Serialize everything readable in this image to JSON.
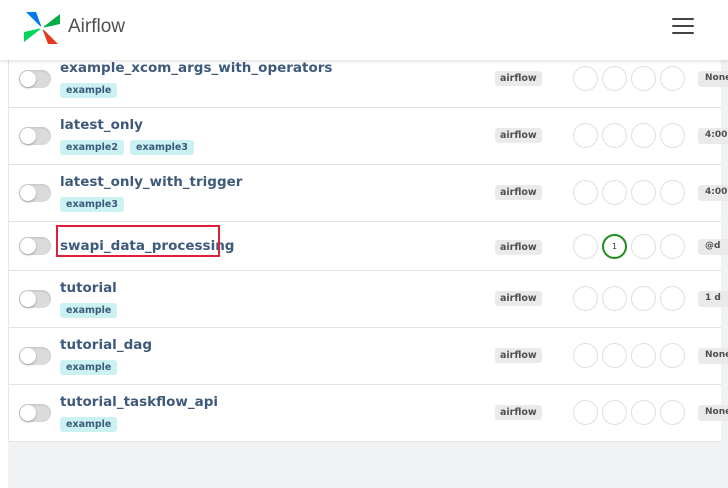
{
  "header": {
    "brand": "Airflow"
  },
  "colors": {
    "link": "#3e5a7a",
    "tag_bg": "#cbf1f3",
    "success": "#1e8f1e",
    "highlight": "#e0203a"
  },
  "dags": [
    {
      "name": "example_xcom_args_with_operators",
      "tags": [
        "example"
      ],
      "owner": "airflow",
      "schedule": "None",
      "recent_circles": [
        "",
        "",
        "",
        ""
      ]
    },
    {
      "name": "latest_only",
      "tags": [
        "example2",
        "example3"
      ],
      "owner": "airflow",
      "schedule": "4:00",
      "recent_circles": [
        "",
        "",
        "",
        ""
      ]
    },
    {
      "name": "latest_only_with_trigger",
      "tags": [
        "example3"
      ],
      "owner": "airflow",
      "schedule": "4:00",
      "recent_circles": [
        "",
        "",
        "",
        ""
      ]
    },
    {
      "name": "swapi_data_processing",
      "tags": [],
      "owner": "airflow",
      "schedule": "@d",
      "recent_circles": [
        "",
        "1",
        "",
        ""
      ],
      "highlighted": true
    },
    {
      "name": "tutorial",
      "tags": [
        "example"
      ],
      "owner": "airflow",
      "schedule": "1 d",
      "recent_circles": [
        "",
        "",
        "",
        ""
      ]
    },
    {
      "name": "tutorial_dag",
      "tags": [
        "example"
      ],
      "owner": "airflow",
      "schedule": "None",
      "recent_circles": [
        "",
        "",
        "",
        ""
      ]
    },
    {
      "name": "tutorial_taskflow_api",
      "tags": [
        "example"
      ],
      "owner": "airflow",
      "schedule": "None",
      "recent_circles": [
        "",
        "",
        "",
        ""
      ]
    }
  ]
}
